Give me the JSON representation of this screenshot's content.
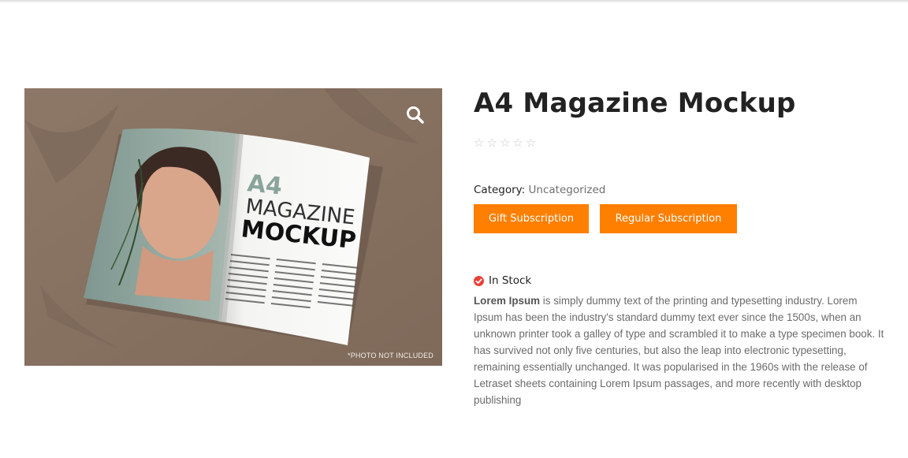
{
  "product": {
    "title": "A4 Magazine Mockup",
    "rating": {
      "stars_filled": 0,
      "stars_total": 5
    },
    "category_label": "Category:",
    "category_value": "Uncategorized",
    "buttons": {
      "gift": "Gift Subscription",
      "regular": "Regular Subscription"
    },
    "stock_status": "In Stock",
    "description_bold": "Lorem Ipsum",
    "description_rest": " is simply dummy text of the printing and typesetting industry. Lorem Ipsum has been the industry's standard dummy text ever since the 1500s, when an unknown printer took a galley of type and scrambled it to make a type specimen book. It has survived not only five centuries, but also the leap into electronic typesetting, remaining essentially unchanged. It was popularised in the 1960s with the release of Letraset sheets containing Lorem Ipsum passages, and more recently with desktop publishing"
  },
  "image": {
    "photo_note": "*PHOTO NOT INCLUDED",
    "magazine_text": {
      "line1": "A4",
      "line2": "MAGAZINE",
      "line3": "MOCKUP"
    }
  },
  "colors": {
    "accent": "#ff7f00",
    "stock_icon": "#e8413a",
    "heading": "#222222",
    "body_text": "#6b6b6b"
  },
  "icons": {
    "zoom": "search-icon",
    "stock": "check-circle-icon",
    "rating": "star-outline-icon"
  }
}
